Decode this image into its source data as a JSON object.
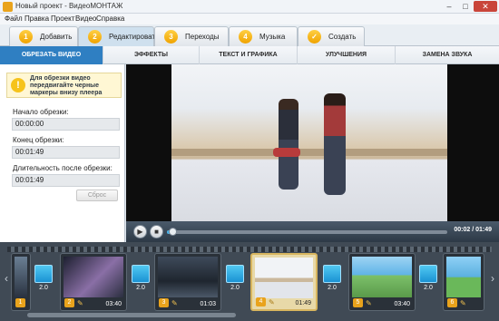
{
  "window": {
    "title": "Новый проект - ВидеоМОНТАЖ",
    "min": "–",
    "max": "□",
    "close": "✕"
  },
  "menu": [
    "Файл",
    "Правка",
    "Проект",
    "Видео",
    "Справка"
  ],
  "steps": [
    {
      "num": "1",
      "label": "Добавить"
    },
    {
      "num": "2",
      "label": "Редактировать"
    },
    {
      "num": "3",
      "label": "Переходы"
    },
    {
      "num": "4",
      "label": "Музыка"
    },
    {
      "num": "✓",
      "label": "Создать"
    }
  ],
  "subtabs": [
    "ОБРЕЗАТЬ ВИДЕО",
    "ЭФФЕКТЫ",
    "ТЕКСТ И ГРАФИКА",
    "УЛУЧШЕНИЯ",
    "ЗАМЕНА ЗВУКА"
  ],
  "trim": {
    "hint": "Для обрезки видео передвигайте черные маркеры внизу плеера",
    "start_label": "Начало обрезки:",
    "start_value": "00:00:00",
    "end_label": "Конец обрезки:",
    "end_value": "00:01:49",
    "length_label": "Длительность после обрезки:",
    "length_value": "00:01:49",
    "reset_label": "Сброс"
  },
  "player": {
    "timecode": "00:02 / 01:49",
    "progress": 0.02
  },
  "timeline": {
    "clips": [
      {
        "index": "1",
        "duration": ""
      },
      {
        "index": "2",
        "duration": "03:40"
      },
      {
        "index": "3",
        "duration": "01:03"
      },
      {
        "index": "4",
        "duration": "01:49"
      },
      {
        "index": "5",
        "duration": "03:40"
      },
      {
        "index": "6",
        "duration": ""
      }
    ],
    "transitions": [
      "2.0",
      "2.0",
      "2.0",
      "2.0",
      "2.0"
    ]
  },
  "colors": {
    "accent": "#2f7fc2",
    "step_badge": "#f0a300",
    "selected_clip": "#d7b55f"
  }
}
